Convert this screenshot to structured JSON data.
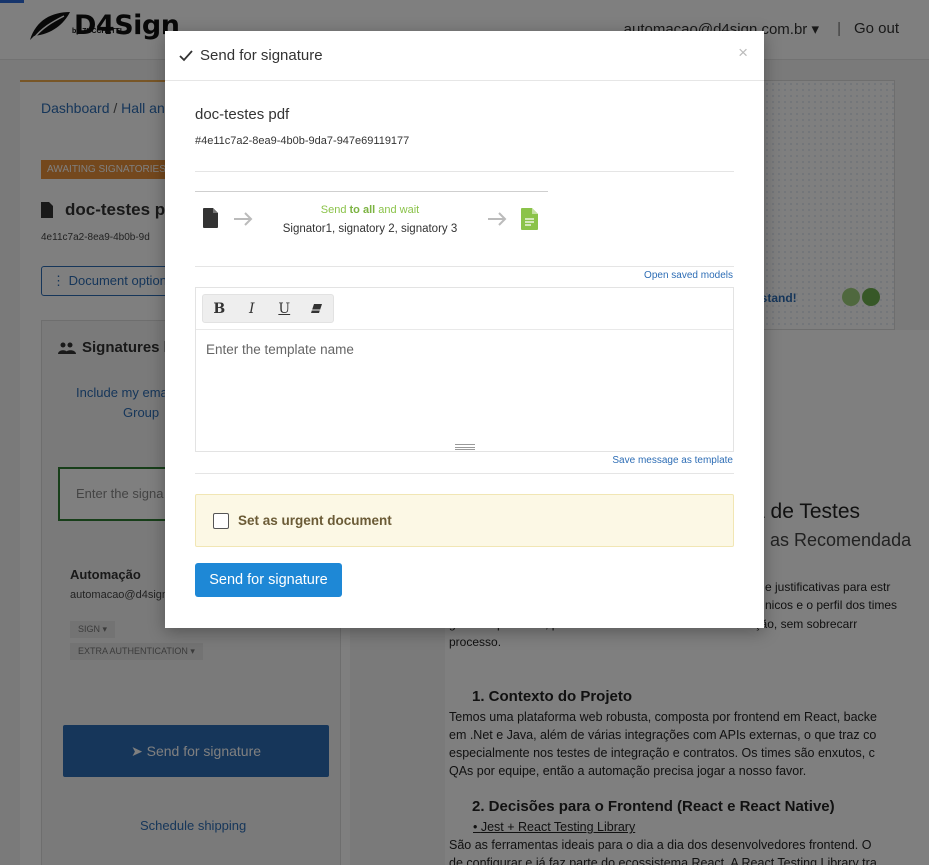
{
  "header": {
    "logo_text": "D4Sign",
    "logo_sub": "by ZUCCHETTI",
    "account_email": "automacao@d4sign.com.br",
    "separator": "|",
    "go_out": "Go out"
  },
  "left": {
    "breadcrumb_dashboard": "Dashboard",
    "breadcrumb_sep": "/",
    "breadcrumb_item": "Hall and",
    "status_badge": "AWAITING SIGNATORIES",
    "doc_title": "doc-testes po",
    "doc_hash": "4e11c7a2-8ea9-4b0b-9d",
    "doc_options": "Document options",
    "signatures_heading": "Signatures li",
    "include_link": "Include my ema",
    "group_link": "Group",
    "signer_input_placeholder": "Enter the signa",
    "signer_name": "Automação",
    "signer_email": "automacao@d4sign",
    "pill_sign": "SIGN",
    "pill_extra": "EXTRA AUTHENTICATION",
    "send_button": "Send for signature",
    "schedule_link": "Schedule shipping"
  },
  "right": {
    "understand": "rstand!"
  },
  "document_preview": {
    "heading1": "égia de Testes",
    "heading2": "as Recomendada",
    "para1_a": "e justificativas para estr",
    "para1_b": "nicos e o perfil dos times",
    "para1_c": "garantir qualidade, produtividade e facilidade de manutenção, sem sobrecarr",
    "para1_d": "processo.",
    "section1": "1.  Contexto do Projeto",
    "section1_lines": [
      "Temos uma plataforma web robusta, composta por frontend em React, backe",
      "em .Net e Java, além de várias integrações com APIs externas, o que traz co",
      "especialmente nos testes de integração e contratos. Os times são enxutos, c",
      "QAs por equipe, então a automação precisa jogar a nosso favor."
    ],
    "section2": "2.  Decisões para o Frontend (React e React Native)",
    "bullet1": "Jest + React Testing Library",
    "section2_lines": [
      "São as ferramentas ideais para o dia a dia dos desenvolvedores frontend. O",
      "de configurar e já faz parte do ecossistema React. A React Testing Library tra"
    ]
  },
  "modal": {
    "title": "Send for signature",
    "close": "×",
    "doc_name": "doc-testes pdf",
    "doc_hash": "#4e11c7a2-8ea9-4b0b-9da7-947e69119177",
    "flow_send_prefix": "Send ",
    "flow_send_bold": "to all",
    "flow_send_suffix": " and wait",
    "flow_signers": "Signator1, signatory 2, signatory 3",
    "open_saved_models": "Open saved models",
    "toolbar": {
      "bold": "B",
      "italic": "I",
      "underline": "U"
    },
    "editor_placeholder": "Enter the template name",
    "save_as_template": "Save message as template",
    "urgent_label": "Set as urgent document",
    "urgent_checked": false,
    "send_button": "Send for signature"
  },
  "colors": {
    "accent_blue": "#1e88d6",
    "link_blue": "#2d6db5",
    "success_green": "#8bc34a",
    "warning_bg": "#fcf8e5",
    "badge_orange": "#e8913b"
  }
}
